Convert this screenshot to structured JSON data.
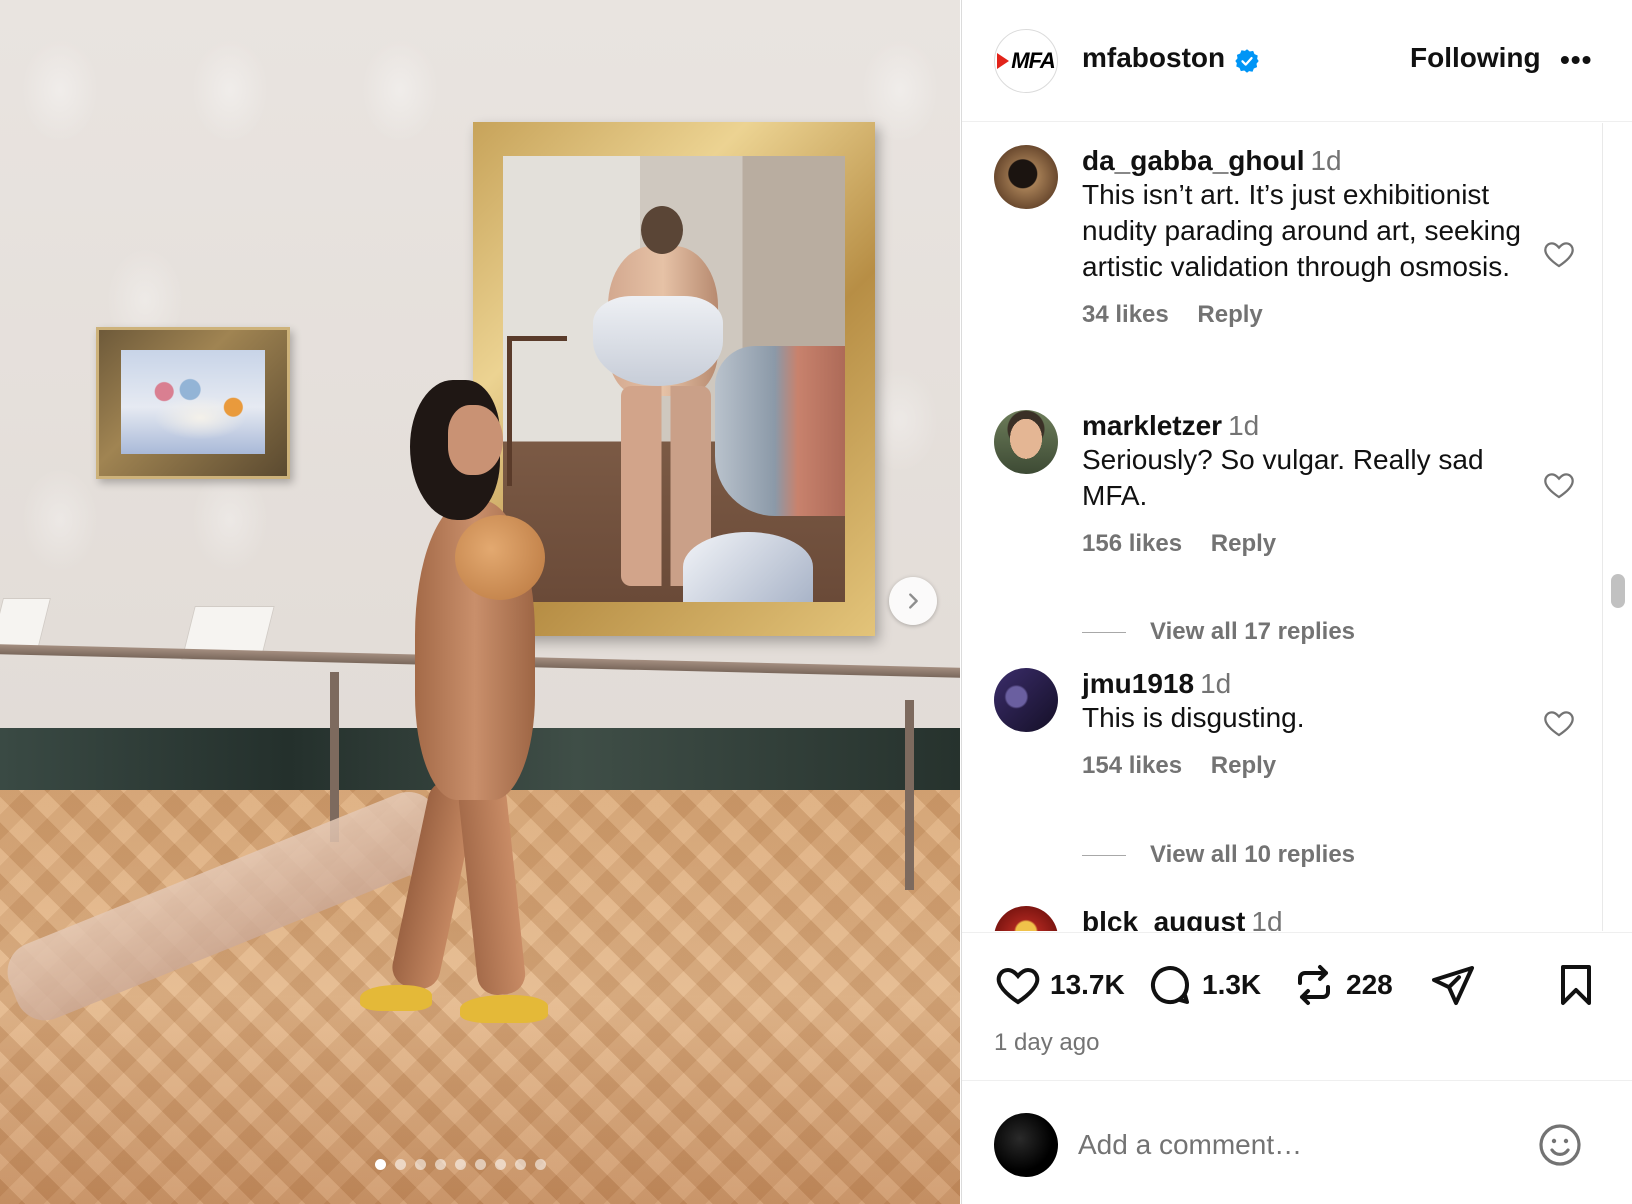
{
  "post": {
    "account": {
      "username": "mfaboston",
      "avatar_text": "MFA",
      "verified": true,
      "follow_state": "Following",
      "more_label": "•••"
    },
    "comments": [
      {
        "username": "da_gabba_ghoul",
        "time": "1d",
        "text": "This isn’t art. It’s just exhibitionist nudity parading around art, seeking artistic validation through osmosis.",
        "likes": "34 likes",
        "reply_label": "Reply",
        "avatar_color": "#6b4a2f"
      },
      {
        "username": "markletzer",
        "time": "1d",
        "text": "Seriously? So vulgar. Really sad MFA.",
        "likes": "156 likes",
        "reply_label": "Reply",
        "view_replies": "View all 17 replies",
        "avatar_color": "#c9a07c"
      },
      {
        "username": "jmu1918",
        "time": "1d",
        "text": "This is disgusting.",
        "likes": "154 likes",
        "reply_label": "Reply",
        "view_replies": "View all 10 replies",
        "avatar_color": "#2b1f4a"
      },
      {
        "username": "blck_august",
        "time": "1d",
        "avatar_color": "#c0261f"
      }
    ],
    "stats": {
      "likes": "13.7K",
      "comments": "1.3K",
      "reposts": "228"
    },
    "posted_ago": "1 day ago",
    "comment_placeholder": "Add a comment…",
    "carousel": {
      "total": 9,
      "active_index": 0
    }
  },
  "icons": {
    "like": "heart-icon",
    "comment": "comment-bubble-icon",
    "repost": "repost-icon",
    "share": "paper-plane-icon",
    "save": "bookmark-icon",
    "emoji": "emoji-icon",
    "next": "chevron-right-icon",
    "verified": "verified-badge-icon"
  },
  "colors": {
    "verified_blue": "#0095f6",
    "text_primary": "#111111",
    "text_secondary": "#737373",
    "mfa_red": "#e2231a"
  }
}
